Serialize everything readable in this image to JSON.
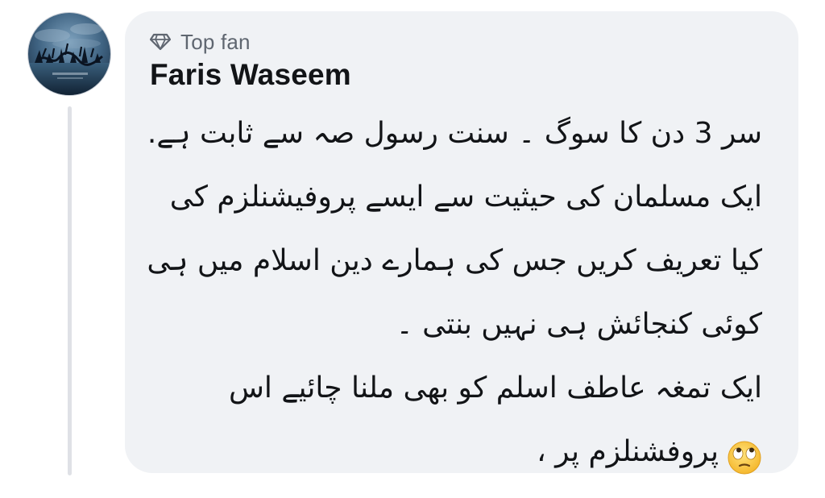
{
  "comment": {
    "badge": "Top fan",
    "author": "Faris Waseem",
    "lines": [
      "سر 3 دن کا سوگ ۔ سنت رسول صہ سے ثابت ہے.",
      "ایک مسلمان کی حیثیت سے ایسے پروفیشنلزم کی",
      "کیا تعریف کریں جس کی ہمارے دین اسلام میں ہی",
      "کوئی کنجائش ہی  نہیں بنتی ۔",
      "ایک تمغہ عاطف اسلم کو بھی ملنا چائیے اس",
      "پروفشنلزم پر ،"
    ],
    "emoji": "face-with-rolling-eyes",
    "badge_icon": "diamond-icon"
  },
  "colors": {
    "bubble": "#f0f2f5",
    "text": "#121417",
    "muted": "#5f6670",
    "thread_line": "#dfe1e6"
  }
}
